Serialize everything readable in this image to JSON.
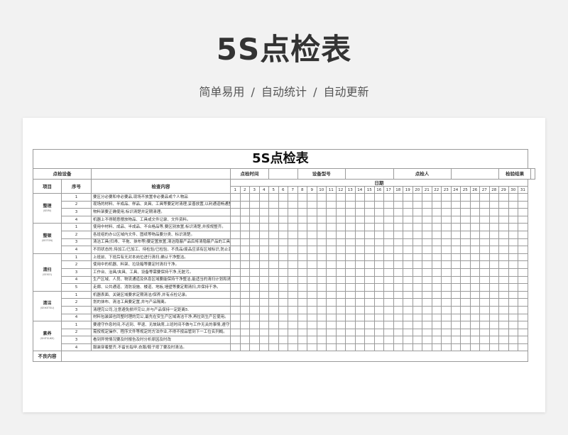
{
  "header": {
    "title": "5S点检表",
    "subtitle": "简单易用 / 自动统计 / 自动更新"
  },
  "sheet": {
    "title": "5S点检表",
    "info": {
      "point_device": "点检设备",
      "point_time": "点检时间",
      "device_model": "设备型号",
      "inspector": "点检人",
      "result": "检验结果"
    },
    "col_headers": {
      "item": "项目",
      "no": "序号",
      "content": "检查内容",
      "date": "日期"
    },
    "days": [
      "1",
      "2",
      "3",
      "4",
      "5",
      "6",
      "7",
      "8",
      "9",
      "10",
      "11",
      "12",
      "13",
      "14",
      "15",
      "16",
      "17",
      "18",
      "19",
      "20",
      "21",
      "22",
      "23",
      "24",
      "25",
      "26",
      "27",
      "28",
      "29",
      "30",
      "31"
    ],
    "categories": [
      {
        "name": "整理",
        "sub": "(SEIRI)",
        "rows": [
          {
            "no": "1",
            "text": "要区分必要和非必要品,现场不放置非必要品或个人物品"
          },
          {
            "no": "2",
            "text": "现场的材料、半成品、样品、夹具、工具等要定时清理,妥善放置,以利通道畅通整洁。"
          },
          {
            "no": "3",
            "text": "物料架要正确使用,标识清楚并定期清理。"
          },
          {
            "no": "4",
            "text": "机器上不得随意摆放物品、工具或文件记录、文件资料。"
          }
        ]
      },
      {
        "name": "整顿",
        "sub": "(SEITON)",
        "rows": [
          {
            "no": "1",
            "text": "使用中材料、成品、半成品、不合格品等,要区别放置,标识清楚,并按规整齐。"
          },
          {
            "no": "2",
            "text": "各班组的办公区域内文件、图纸等物品要分类、标识清楚。"
          },
          {
            "no": "3",
            "text": "清洁工具(扫帚、平拖、抹布等)要定置放置,清洁隐蔽产品后将清隐蔽产品的工具要分别使用,隔离放置。"
          },
          {
            "no": "4",
            "text": "不同状态的,待加工/已加工、待检验/已检验、不良品/废品应该有区域标识,防止混淆。"
          }
        ]
      },
      {
        "name": "清扫",
        "sub": "(SEISO)",
        "rows": [
          {
            "no": "1",
            "text": "上班前、下班后有无对本岗位进行清扫,确认干净整洁。"
          },
          {
            "no": "2",
            "text": "使用中的机器、料架、垃圾箱等要定时清扫干净。"
          },
          {
            "no": "3",
            "text": "工作台、治具/夹具、工具、设备等需要保持干净,无脏污。"
          },
          {
            "no": "4",
            "text": "生产区域、人员、物流通道及休息区域要能保持干净整洁,能适当的清扫计划和清扫频率。"
          },
          {
            "no": "5",
            "text": "走廊、公共通道、消防设施、楼道、地板,墙壁等要定期清扫,并保持干净。"
          }
        ]
      },
      {
        "name": "清洁",
        "sub": "(SEIKETSU)",
        "rows": [
          {
            "no": "1",
            "text": "机器表面、关键区域要求定期清洁/保养,并有点检记录。"
          },
          {
            "no": "2",
            "text": "划的抹布、清洁工具要定置,并与产品隔离。"
          },
          {
            "no": "3",
            "text": "清理完公司,注意避免损坏完公,并与产品保持一定距离5."
          },
          {
            "no": "4",
            "text": "材料包装袋也同整时理的完公,最先在安生产区域清洁干净,再拉到生产区使用。"
          }
        ]
      },
      {
        "name": "素养",
        "sub": "(SHITSUKE)",
        "rows": [
          {
            "no": "1",
            "text": "要遵守作息时间,不迟到、早退、无故缺席,上班时间不做与工作无关的事情,遵守公司规章制度。"
          },
          {
            "no": "2",
            "text": "需按规定操作、程序文件等规定的方法作业,不得不按品管到下一工位名列概。"
          },
          {
            "no": "3",
            "text": "看到异常情况要及时报告及时分析原因及时改"
          },
          {
            "no": "4",
            "text": "服装穿着整齐,不留长指甲,衣服/鞋子按了要及时清洁。"
          }
        ]
      }
    ],
    "defect_label": "不良内容"
  }
}
